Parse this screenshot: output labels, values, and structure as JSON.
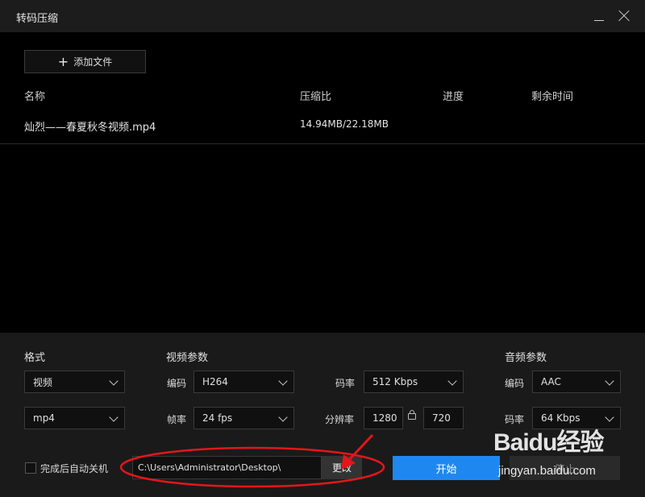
{
  "window": {
    "title": "转码压缩"
  },
  "toolbar": {
    "add_file": "添加文件"
  },
  "columns": {
    "name": "名称",
    "ratio": "压缩比",
    "progress": "进度",
    "remaining": "剩余时间"
  },
  "files": [
    {
      "name": "灿烈——春夏秋冬视频.mp4",
      "ratio": "14.94MB/22.18MB"
    }
  ],
  "format": {
    "label": "格式",
    "type": "视频",
    "container": "mp4"
  },
  "video": {
    "label": "视频参数",
    "codec_label": "编码",
    "codec": "H264",
    "fps_label": "帧率",
    "fps": "24 fps",
    "bitrate_label": "码率",
    "bitrate": "512 Kbps",
    "resolution_label": "分辨率",
    "width": "1280",
    "height": "720"
  },
  "audio": {
    "label": "音频参数",
    "codec_label": "编码",
    "codec": "AAC",
    "bitrate_label": "码率",
    "bitrate": "64 Kbps"
  },
  "footer": {
    "shutdown_label": "完成后自动关机",
    "output_path": "C:\\Users\\Administrator\\Desktop\\",
    "change_label": "更改",
    "start_label": "开始",
    "stop_label": "停止"
  },
  "watermark": {
    "text": "Baidu经验",
    "url": "jingyan.baidu.com"
  },
  "colors": {
    "accent": "#1e88f0",
    "annotation": "#e3161b",
    "background": "#000000",
    "panel": "#1a1a1a"
  }
}
